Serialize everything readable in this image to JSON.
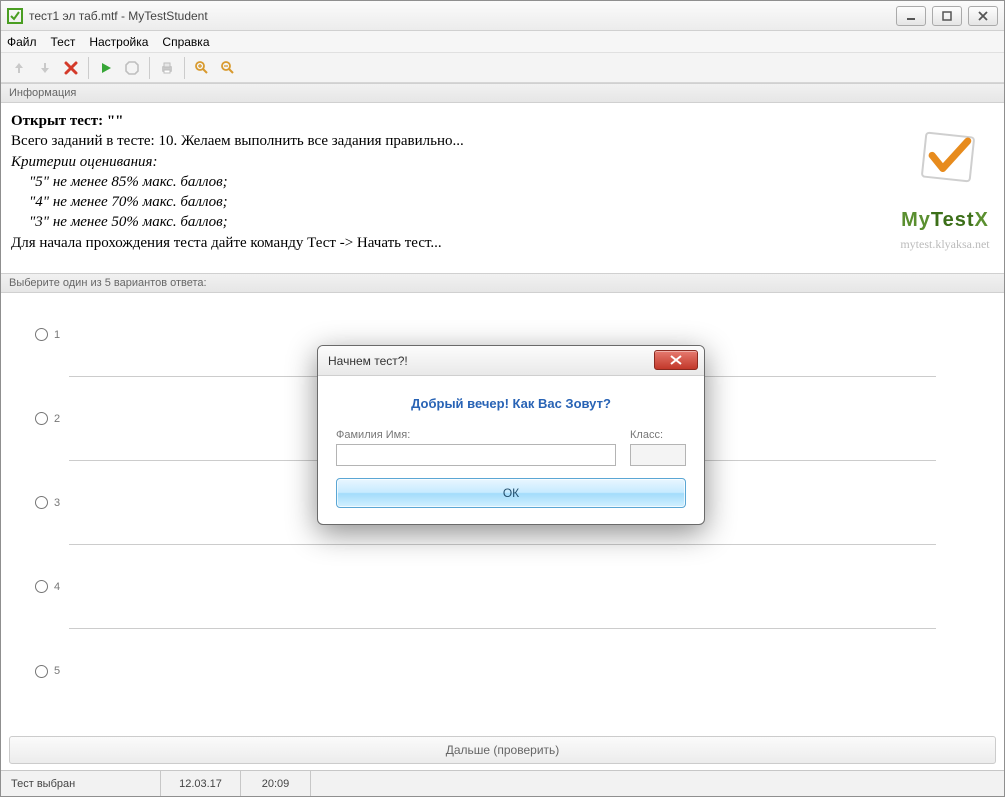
{
  "window": {
    "title": "тест1 эл таб.mtf - MyTestStudent"
  },
  "menu": {
    "file": "Файл",
    "test": "Тест",
    "settings": "Настройка",
    "help": "Справка"
  },
  "info_header": "Информация",
  "info": {
    "opened_label": "Открыт тест: \"\"",
    "total_line": "Всего заданий в тесте: 10. Желаем выполнить все задания правильно...",
    "criteria_label": "Критерии оценивания:",
    "c5": "\"5\" не менее 85% макс. баллов;",
    "c4": "\"4\" не менее 70% макс. баллов;",
    "c3": "\"3\" не менее 50% макс. баллов;",
    "start_hint": "Для начала прохождения теста дайте команду Тест -> Начать тест..."
  },
  "logo": {
    "brand_my": "My",
    "brand_test": "Test",
    "brand_x": "X",
    "url": "mytest.klyaksa.net"
  },
  "answers_header": "Выберите один из 5 вариантов ответа:",
  "answers": [
    "1",
    "2",
    "3",
    "4",
    "5"
  ],
  "next_button": "Дальше (проверить)",
  "status": {
    "state": "Тест выбран",
    "date": "12.03.17",
    "time": "20:09"
  },
  "dialog": {
    "title": "Начнем тест?!",
    "greeting": "Добрый вечер! Как Вас Зовут?",
    "name_label": "Фамилия Имя:",
    "class_label": "Класс:",
    "name_value": "",
    "class_value": "",
    "ok": "ОК"
  }
}
